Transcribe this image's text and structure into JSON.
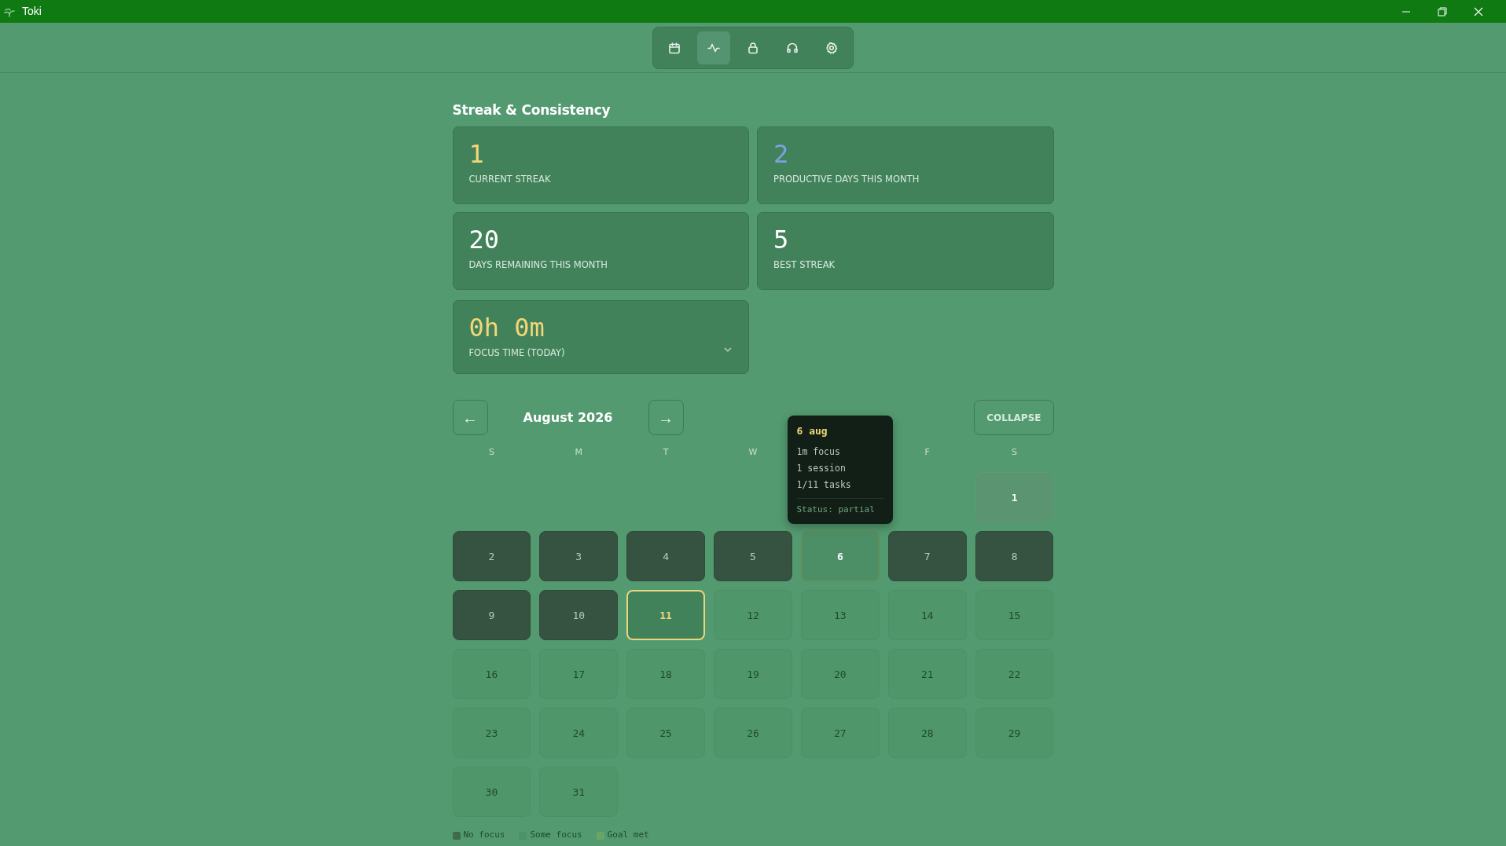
{
  "window": {
    "title": "Toki"
  },
  "toolbar": [
    {
      "kind": "calendar",
      "selected": false
    },
    {
      "kind": "activity",
      "selected": true
    },
    {
      "kind": "lock",
      "selected": false
    },
    {
      "kind": "headphones",
      "selected": false
    },
    {
      "kind": "settings",
      "selected": false
    }
  ],
  "section_title": "Streak & Consistency",
  "stats": [
    {
      "value": "1",
      "label": "CURRENT STREAK",
      "color": "#f2d77a"
    },
    {
      "value": "2",
      "label": "PRODUCTIVE DAYS THIS MONTH",
      "color": "#7aa2e0"
    },
    {
      "value": "20",
      "label": "DAYS REMAINING THIS MONTH",
      "color": "#ffffff"
    },
    {
      "value": "5",
      "label": "BEST STREAK",
      "color": "#ffffff"
    }
  ],
  "focus_card": {
    "value": "0h 0m",
    "label": "FOCUS TIME (TODAY)",
    "expanded": false
  },
  "calendar": {
    "prev": "←",
    "month": "August 2026",
    "next": "→",
    "collapse": "COLLAPSE",
    "weekdays": [
      {
        "kind": "label",
        "label": "S"
      },
      {
        "kind": "label",
        "label": "M"
      },
      {
        "kind": "label",
        "label": "T"
      },
      {
        "kind": "label",
        "label": "W"
      },
      {
        "kind": "covered"
      },
      {
        "kind": "label",
        "label": "F"
      },
      {
        "kind": "label",
        "label": "S"
      }
    ],
    "days": [
      {
        "kind": "blank"
      },
      {
        "kind": "blank"
      },
      {
        "kind": "blank"
      },
      {
        "kind": "blank"
      },
      {
        "kind": "blank"
      },
      {
        "kind": "blank"
      },
      {
        "kind": "some",
        "label": "1",
        "selected": false
      },
      {
        "kind": "none",
        "label": "2",
        "selected": false
      },
      {
        "kind": "none",
        "label": "3",
        "selected": false
      },
      {
        "kind": "none",
        "label": "4",
        "selected": false
      },
      {
        "kind": "none",
        "label": "5",
        "selected": false
      },
      {
        "kind": "some",
        "label": "6",
        "selected": true
      },
      {
        "kind": "none",
        "label": "7",
        "selected": false
      },
      {
        "kind": "none",
        "label": "8",
        "selected": false
      },
      {
        "kind": "none",
        "label": "9",
        "selected": false
      },
      {
        "kind": "none",
        "label": "10",
        "selected": false
      },
      {
        "kind": "today",
        "label": "11",
        "selected": false
      },
      {
        "kind": "upcoming",
        "label": "12",
        "selected": false
      },
      {
        "kind": "upcoming",
        "label": "13",
        "selected": false
      },
      {
        "kind": "upcoming",
        "label": "14",
        "selected": false
      },
      {
        "kind": "upcoming",
        "label": "15",
        "selected": false
      },
      {
        "kind": "upcoming",
        "label": "16",
        "selected": false
      },
      {
        "kind": "upcoming",
        "label": "17",
        "selected": false
      },
      {
        "kind": "upcoming",
        "label": "18",
        "selected": false
      },
      {
        "kind": "upcoming",
        "label": "19",
        "selected": false
      },
      {
        "kind": "upcoming",
        "label": "20",
        "selected": false
      },
      {
        "kind": "upcoming",
        "label": "21",
        "selected": false
      },
      {
        "kind": "upcoming",
        "label": "22",
        "selected": false
      },
      {
        "kind": "upcoming",
        "label": "23",
        "selected": false
      },
      {
        "kind": "upcoming",
        "label": "24",
        "selected": false
      },
      {
        "kind": "upcoming",
        "label": "25",
        "selected": false
      },
      {
        "kind": "upcoming",
        "label": "26",
        "selected": false
      },
      {
        "kind": "upcoming",
        "label": "27",
        "selected": false
      },
      {
        "kind": "upcoming",
        "label": "28",
        "selected": false
      },
      {
        "kind": "upcoming",
        "label": "29",
        "selected": false
      },
      {
        "kind": "upcoming",
        "label": "30",
        "selected": false
      },
      {
        "kind": "upcoming",
        "label": "31",
        "selected": false
      }
    ],
    "tooltip": {
      "title": "6 aug",
      "lines": [
        "1m focus",
        "1 session",
        "1/11 tasks"
      ],
      "status": "Status: partial"
    },
    "legend": [
      {
        "label": "No focus",
        "color": "#3f6a4c"
      },
      {
        "label": "Some focus",
        "color": "#4e9168"
      },
      {
        "label": "Goal met",
        "color": "#6aa565"
      }
    ]
  }
}
